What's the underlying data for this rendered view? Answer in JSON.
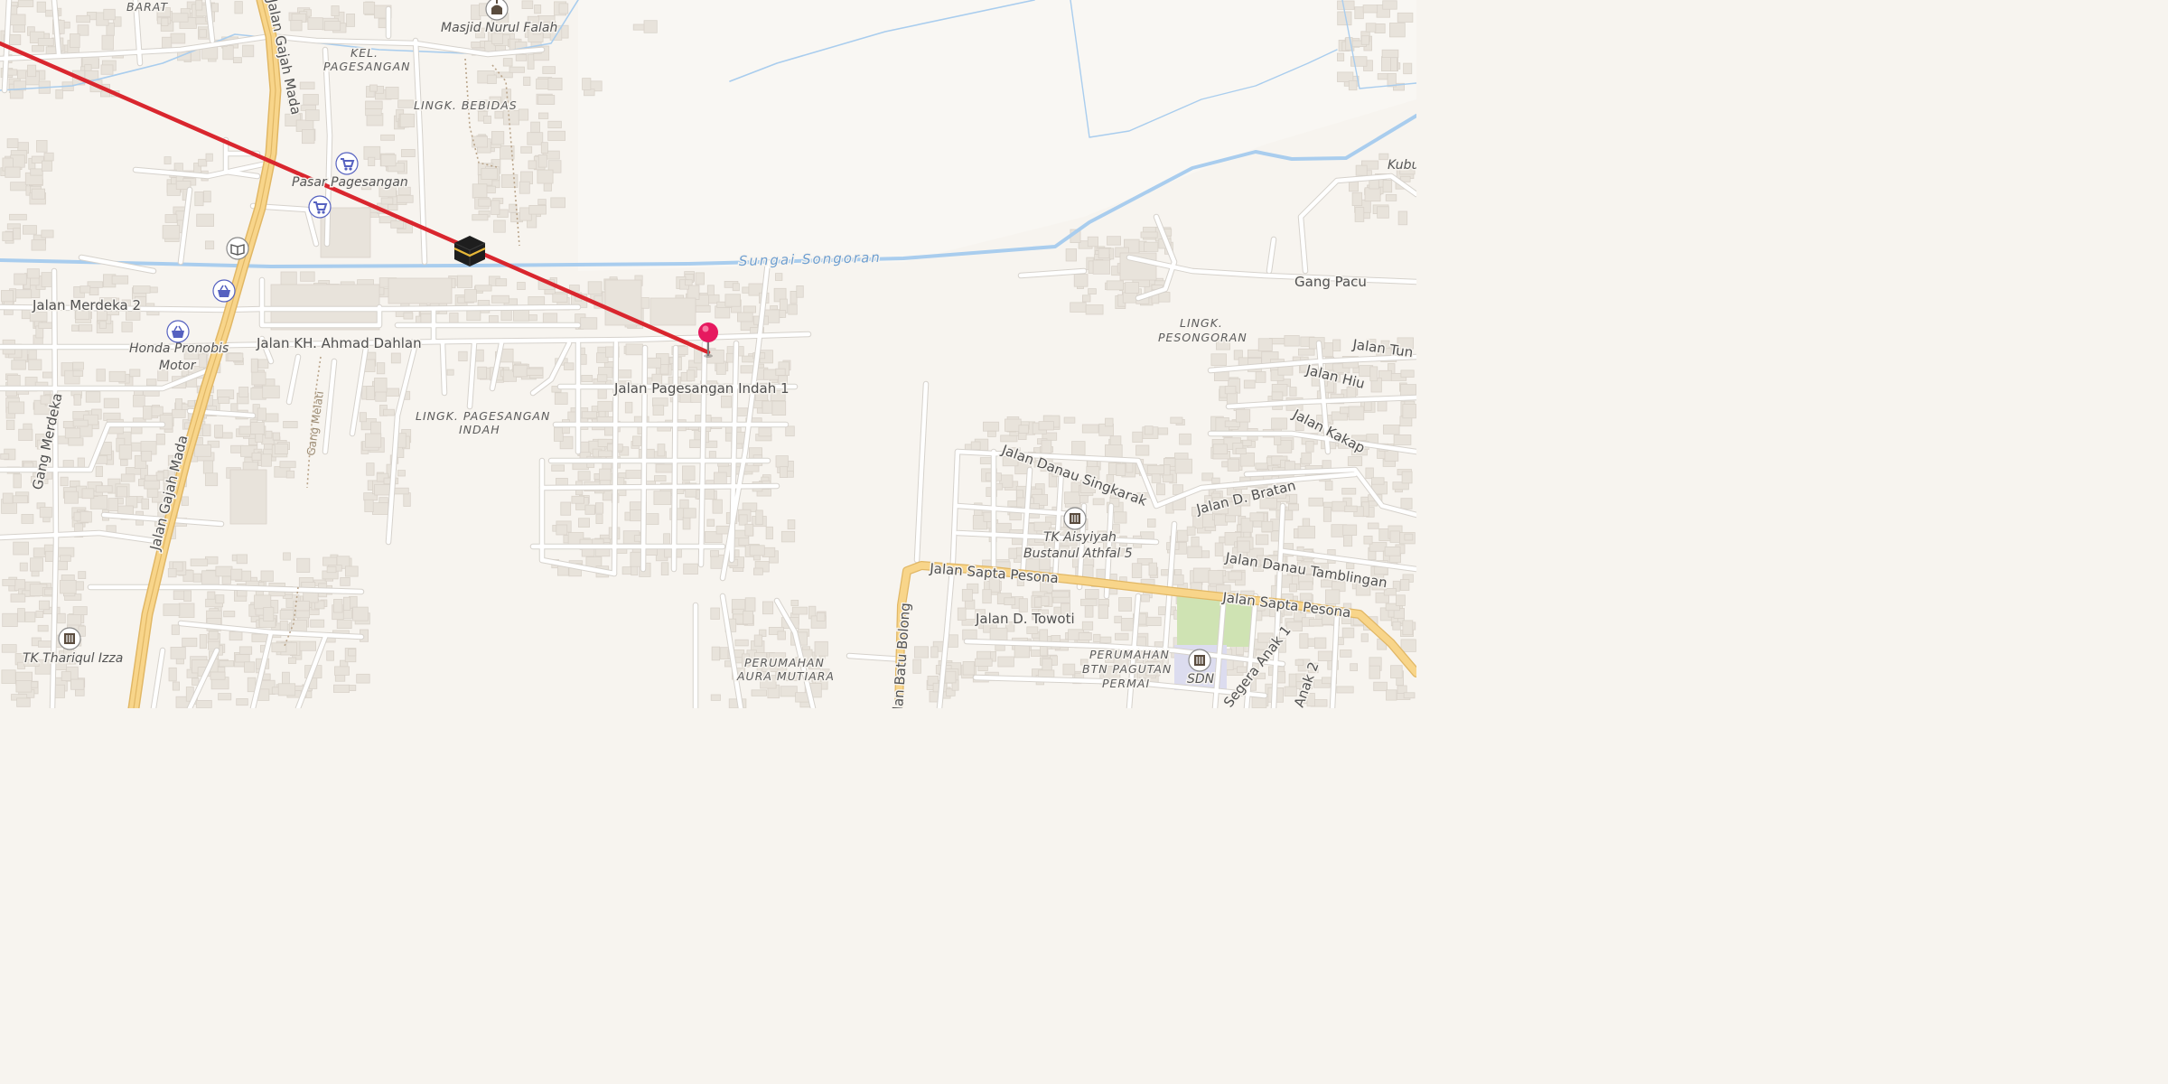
{
  "map": {
    "colors": {
      "land": "#f7f4ef",
      "water": "#a9cdee",
      "building": "#e8e3db",
      "major_road": "#f8d58a",
      "route_line": "#d9262e",
      "pin": "#e6195f",
      "poi_blue": "#5561c0",
      "park": "#cfe3b3"
    },
    "water_labels": {
      "sungai_songoran": "Sungai Songoran"
    },
    "roads": {
      "jalan_gajah_mada_top": "Jalan Gajah Mada",
      "jalan_gajah_mada_bottom": "Jalan Gajah Mada",
      "jalan_merdeka_2": "Jalan Merdeka 2",
      "jalan_kh_ahmad_dahlan": "Jalan KH. Ahmad Dahlan",
      "jalan_pagesangan_indah_1": "Jalan Pagesangan Indah 1",
      "gang_merdeka": "Gang Merdeka",
      "gang_melati": "Gang Melati",
      "gang_pacu": "Gang Pacu",
      "jalan_tun": "Jalan Tun",
      "jalan_hiu": "Jalan Hiu",
      "jalan_kakap": "Jalan Kakap",
      "jalan_danau_singkarak": "Jalan Danau Singkarak",
      "jalan_d_bratan": "Jalan D. Bratan",
      "jalan_danau_tamblingan": "Jalan Danau Tamblingan",
      "jalan_sapta_pesona_left": "Jalan Sapta Pesona",
      "jalan_sapta_pesona_right": "Jalan Sapta Pesona",
      "jalan_d_towoti": "Jalan D. Towoti",
      "jalan_batu_bolong": "Jalan Batu Bolong",
      "segera_anak_1": "Segera Anak 1",
      "anak_2": "Anak 2"
    },
    "areas": {
      "barat": "BARAT",
      "kel_pagesangan_1": "KEL.",
      "kel_pagesangan_2": "PAGESANGAN",
      "lingk_bebidas": "LINGK. BEBIDAS",
      "lingk_pagesangan_indah_1": "LINGK. PAGESANGAN",
      "lingk_pagesangan_indah_2": "INDAH",
      "lingk_pesongoran_1": "LINGK.",
      "lingk_pesongoran_2": "PESONGORAN",
      "perumahan_aura_mutiara_1": "PERUMAHAN",
      "perumahan_aura_mutiara_2": "AURA MUTIARA",
      "perumahan_btn_1": "PERUMAHAN",
      "perumahan_btn_2": "BTN PAGUTAN",
      "perumahan_btn_3": "PERMAI",
      "kubu": "Kubu"
    },
    "pois": {
      "masjid_nurul_falah": "Masjid Nurul Falah",
      "pasar_pagesangan": "Pasar Pagesangan",
      "honda_pronobis_1": "Honda Pronobis",
      "honda_pronobis_2": "Motor",
      "tk_aisyiyah_1": "TK Aisyiyah",
      "tk_aisyiyah_2": "Bustanul Athfal 5",
      "tk_thariqul_izza": "TK Thariqul Izza",
      "sdn": "SDN"
    },
    "icons": {
      "mosque": "mosque-icon",
      "shopping_cart": "shopping-cart-icon",
      "shopping_basket": "shopping-basket-icon",
      "book": "book-icon",
      "school": "school-icon",
      "kaaba": "kaaba-icon",
      "pin": "location-pin-icon"
    }
  }
}
